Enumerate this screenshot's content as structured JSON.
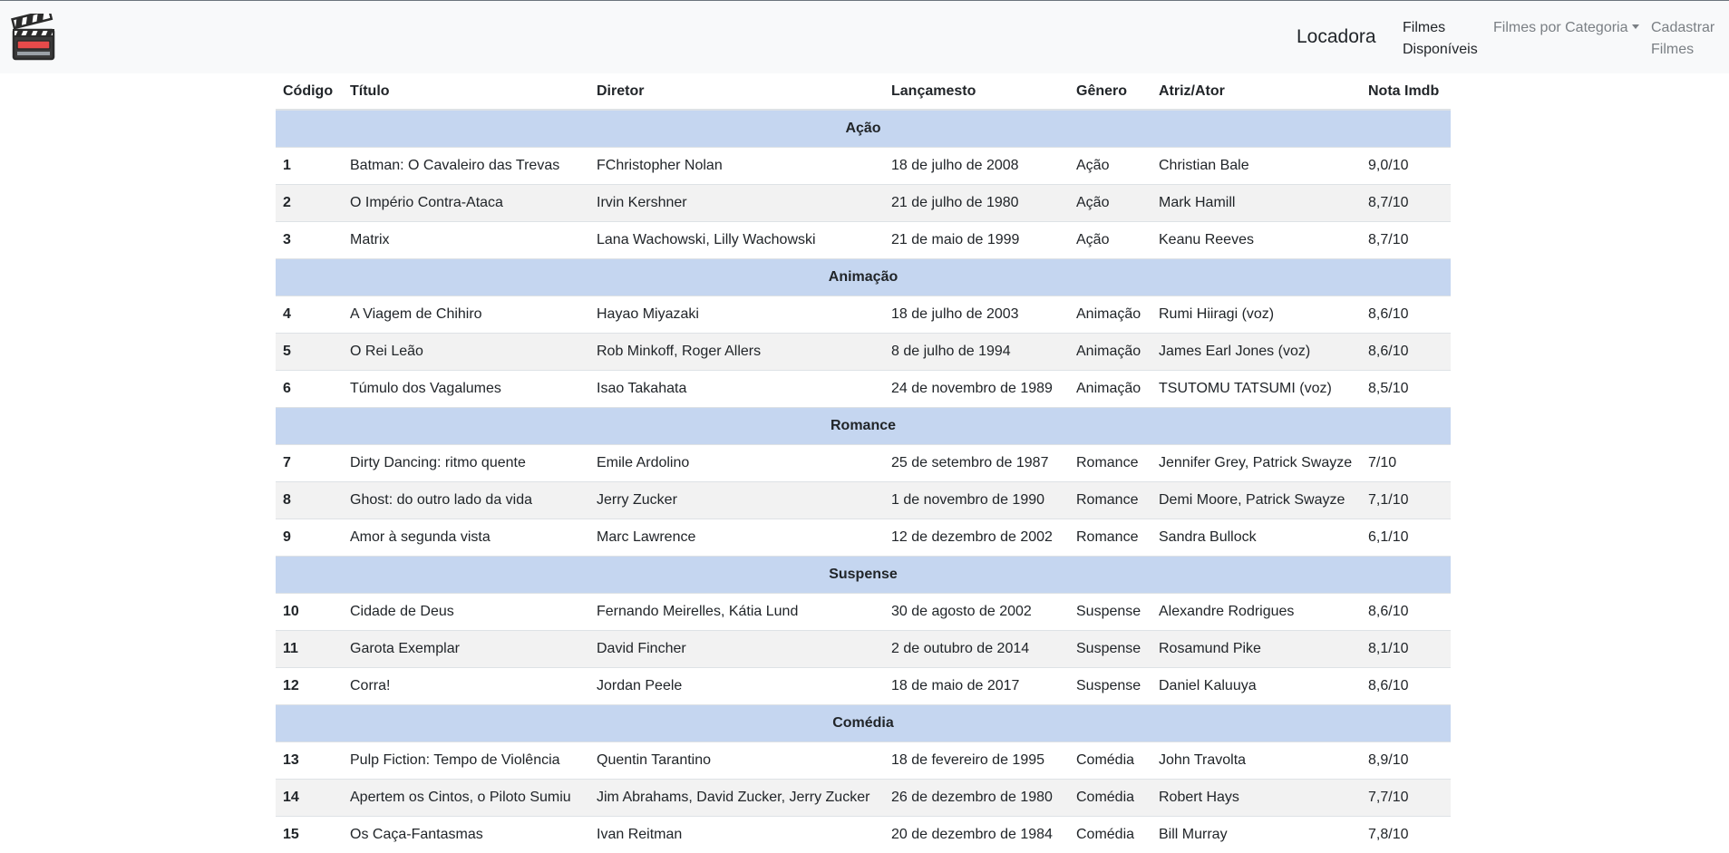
{
  "navbar": {
    "brand": "Locadora",
    "links": {
      "available": "Filmes Disponíveis",
      "category": "Filmes por Categoria",
      "register": "Cadastrar Filmes"
    }
  },
  "table": {
    "headers": [
      "Código",
      "Título",
      "Diretor",
      "Lançamesto",
      "Gênero",
      "Atriz/Ator",
      "Nota Imdb"
    ],
    "groups": [
      {
        "category": "Ação",
        "rows": [
          [
            "1",
            "Batman: O Cavaleiro das Trevas",
            "FChristopher Nolan",
            "18 de julho de 2008",
            "Ação",
            "Christian Bale",
            "9,0/10"
          ],
          [
            "2",
            "O Império Contra-Ataca",
            "Irvin Kershner",
            "21 de julho de 1980",
            "Ação",
            "Mark Hamill",
            "8,7/10"
          ],
          [
            "3",
            "Matrix",
            "Lana Wachowski, Lilly Wachowski",
            "21 de maio de 1999",
            "Ação",
            "Keanu Reeves",
            "8,7/10"
          ]
        ]
      },
      {
        "category": "Animação",
        "rows": [
          [
            "4",
            "A Viagem de Chihiro",
            "Hayao Miyazaki",
            "18 de julho de 2003",
            "Animação",
            "Rumi Hiiragi (voz)",
            "8,6/10"
          ],
          [
            "5",
            "O Rei Leão",
            "Rob Minkoff, Roger Allers",
            "8 de julho de 1994",
            "Animação",
            "James Earl Jones (voz)",
            "8,6/10"
          ],
          [
            "6",
            "Túmulo dos Vagalumes",
            "Isao Takahata",
            "24 de novembro de 1989",
            "Animação",
            "TSUTOMU TATSUMI (voz)",
            "8,5/10"
          ]
        ]
      },
      {
        "category": "Romance",
        "rows": [
          [
            "7",
            "Dirty Dancing: ritmo quente",
            "Emile Ardolino",
            "25 de setembro de 1987",
            "Romance",
            "Jennifer Grey, Patrick Swayze",
            "7/10"
          ],
          [
            "8",
            "Ghost: do outro lado da vida",
            "Jerry Zucker",
            "1 de novembro de 1990",
            "Romance",
            "Demi Moore, Patrick Swayze",
            "7,1/10"
          ],
          [
            "9",
            "Amor à segunda vista",
            "Marc Lawrence",
            "12 de dezembro de 2002",
            "Romance",
            "Sandra Bullock",
            "6,1/10"
          ]
        ]
      },
      {
        "category": "Suspense",
        "rows": [
          [
            "10",
            "Cidade de Deus",
            "Fernando Meirelles, Kátia Lund",
            "30 de agosto de 2002",
            "Suspense",
            "Alexandre Rodrigues",
            "8,6/10"
          ],
          [
            "11",
            "Garota Exemplar",
            "David Fincher",
            "2 de outubro de 2014",
            "Suspense",
            "Rosamund Pike",
            "8,1/10"
          ],
          [
            "12",
            "Corra!",
            "Jordan Peele",
            "18 de maio de 2017",
            "Suspense",
            "Daniel Kaluuya",
            "8,6/10"
          ]
        ]
      },
      {
        "category": "Comédia",
        "rows": [
          [
            "13",
            "Pulp Fiction: Tempo de Violência",
            "Quentin Tarantino",
            "18 de fevereiro de 1995",
            "Comédia",
            "John Travolta",
            "8,9/10"
          ],
          [
            "14",
            "Apertem os Cintos, o Piloto Sumiu",
            "Jim Abrahams, David Zucker, Jerry Zucker",
            "26 de dezembro de 1980",
            "Comédia",
            "Robert Hays",
            "7,7/10"
          ],
          [
            "15",
            "Os Caça-Fantasmas",
            "Ivan Reitman",
            "20 de dezembro de 1984",
            "Comédia",
            "Bill Murray",
            "7,8/10"
          ]
        ]
      }
    ]
  },
  "icons": {
    "logo": "clapperboard-icon",
    "dropdown": "caret-down-icon"
  },
  "colors": {
    "navbar_bg": "#f8f9fa",
    "category_row_bg": "#c5d6f0",
    "stripe_bg": "#f2f2f2"
  }
}
